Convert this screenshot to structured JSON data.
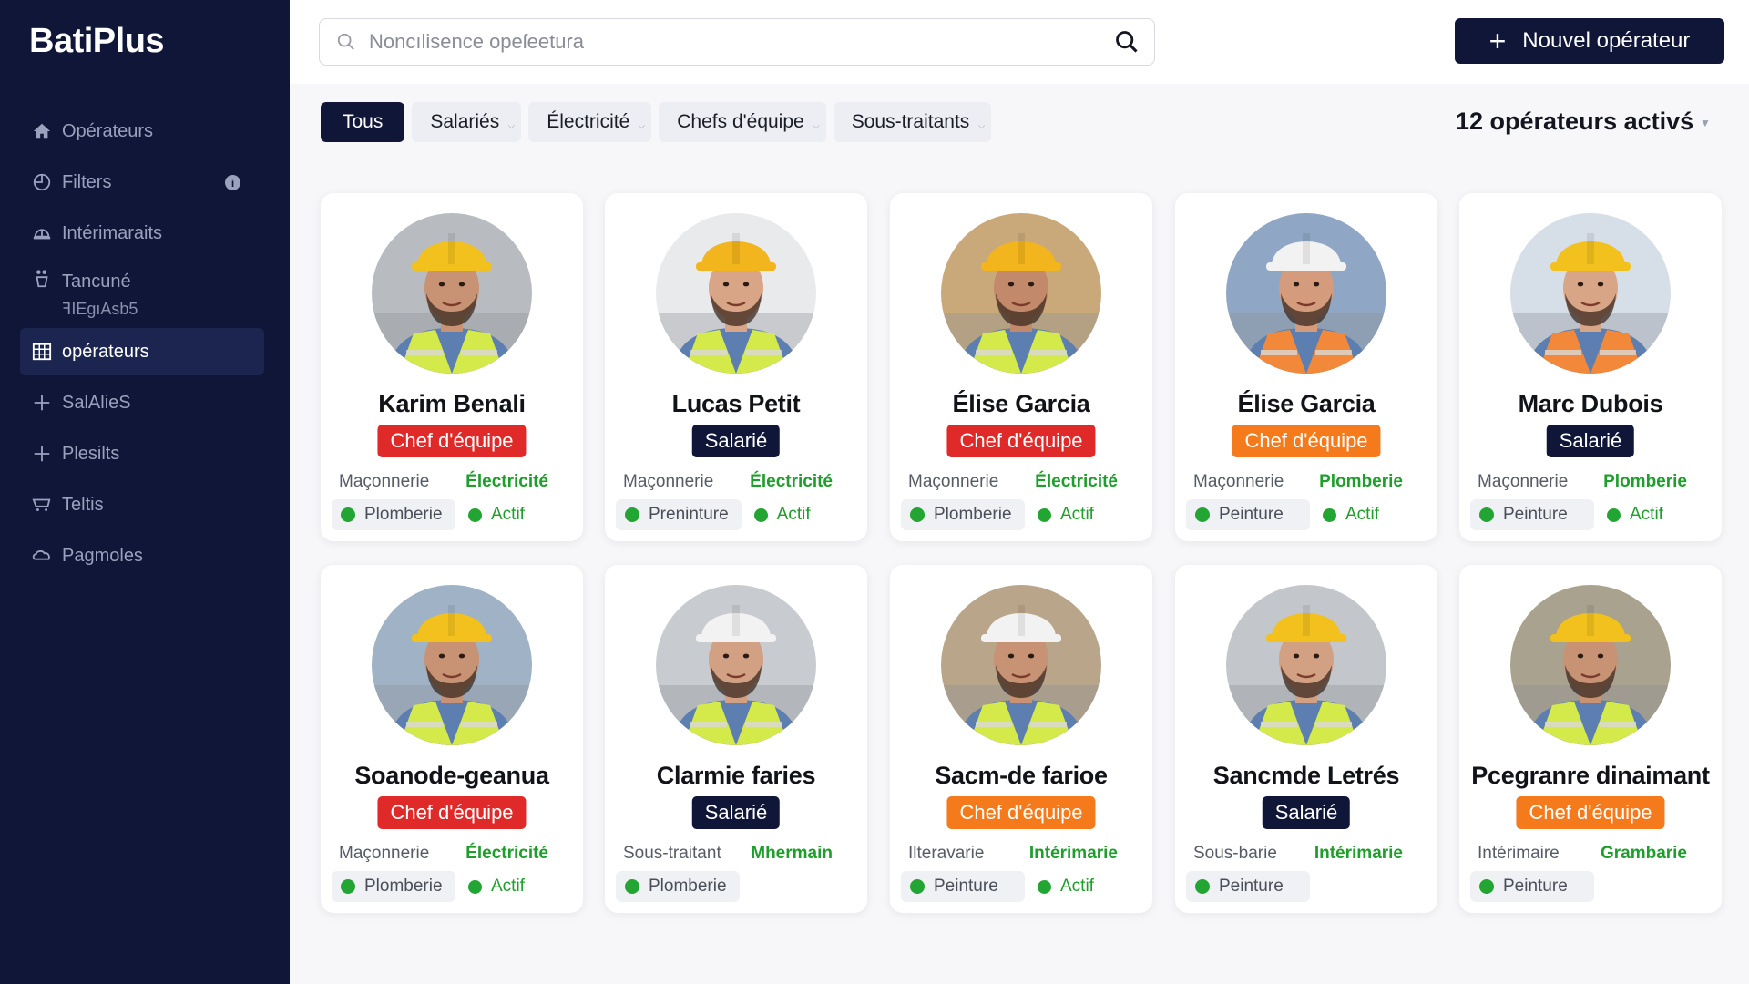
{
  "app": {
    "brand": "BatiPlus"
  },
  "sidebar": {
    "items": [
      {
        "label": "Opérateurs",
        "icon": "home-icon"
      },
      {
        "label": "Filters",
        "icon": "clock-icon",
        "info": "i"
      },
      {
        "label": "Intérimaraits",
        "icon": "helmet-icon"
      },
      {
        "label": "Tancuné",
        "sub": "ꟻIEgıAsb5",
        "icon": "person-icon"
      },
      {
        "label": "opérateurs",
        "icon": "grid-icon",
        "active": true
      },
      {
        "label": "SalAlieS",
        "icon": "plus-icon"
      },
      {
        "label": "Plesilts",
        "icon": "plus-icon"
      },
      {
        "label": "Teltis",
        "icon": "cart-icon"
      },
      {
        "label": "Pagmoles",
        "icon": "cloud-icon"
      }
    ]
  },
  "topbar": {
    "search_placeholder": "Noncılisence opeſeetuɾa",
    "new_button": "Nouvel opérateur"
  },
  "filters": {
    "chips": [
      {
        "label": "Tous",
        "active": true
      },
      {
        "label": "Salariés"
      },
      {
        "label": "Électricité"
      },
      {
        "label": "Chefs d'équipe"
      },
      {
        "label": "Sous-traitants"
      }
    ],
    "count_label": "12 opérateurs activś"
  },
  "colors": {
    "navy": "#0f1638",
    "red_badge": "#e02a2a",
    "orange_badge": "#f57a1c",
    "green": "#22a532"
  },
  "operators": [
    {
      "name": "Karim Benali",
      "role": "Chef d'équipe",
      "role_color": "#e02a2a",
      "left": "Maçonnerie",
      "right": "Électricité",
      "pill": "Plomberie",
      "status": "Actif",
      "helmet": "#f2c11d",
      "vest": "#d4ea4a",
      "skin": "#c89274",
      "bg": "#b8bcc0"
    },
    {
      "name": "Lucas Petit",
      "role": "Salarié",
      "role_color": "#0f1638",
      "left": "Maçonnerie",
      "right": "Électricité",
      "pill": "Preninture",
      "status": "Actif",
      "helmet": "#f2b51d",
      "vest": "#d4ea4a",
      "skin": "#d9a587",
      "bg": "#e9eaec"
    },
    {
      "name": "Élise Garcia",
      "role": "Chef d'équipe",
      "role_color": "#e02a2a",
      "left": "Maçonnerie",
      "right": "Électricité",
      "pill": "Plomberie",
      "status": "Actif",
      "helmet": "#f2b51d",
      "vest": "#d4ea4a",
      "skin": "#c28a6a",
      "bg": "#c9a97a"
    },
    {
      "name": "Élise Garcia",
      "role": "Chef d'équipe",
      "role_color": "#f57a1c",
      "left": "Maçonnerie",
      "right": "Plomberie",
      "pill": "Peinture",
      "status": "Actif",
      "helmet": "#f2f2f2",
      "vest": "#f2893a",
      "skin": "#d49c7c",
      "bg": "#8fa6c4"
    },
    {
      "name": "Marc Dubois",
      "role": "Salarié",
      "role_color": "#0f1638",
      "left": "Maçonnerie",
      "right": "Plomberie",
      "pill": "Peinture",
      "status": "Actif",
      "helmet": "#f2c11d",
      "vest": "#f2893a",
      "skin": "#d9a587",
      "bg": "#d6dee8"
    },
    {
      "name": "Soanode-geanua",
      "role": "Chef d'équipe",
      "role_color": "#e02a2a",
      "left": "Maçonnerie",
      "right": "Électricité",
      "pill": "Plomberie",
      "status": "Actif",
      "helmet": "#f2c11d",
      "vest": "#d4ea4a",
      "skin": "#c89274",
      "bg": "#9fb2c6"
    },
    {
      "name": "Clarmie faries",
      "role": "Salarié",
      "role_color": "#0f1638",
      "left": "Sous-traitant",
      "right": "Mhermain",
      "pill": "Plomberie",
      "status": "",
      "helmet": "#f2f2f2",
      "vest": "#d4ea4a",
      "skin": "#d2a082",
      "bg": "#c8ccd0"
    },
    {
      "name": "Sacm-de farioe",
      "role": "Chef d'équipe",
      "role_color": "#f57a1c",
      "left": "Ilteravarie",
      "right": "Intérimarie",
      "pill": "Peinture",
      "status": "Actif",
      "helmet": "#f2f2f2",
      "vest": "#d4ea4a",
      "skin": "#c89274",
      "bg": "#b9a58a"
    },
    {
      "name": "Sancmde Letrés",
      "role": "Salarié",
      "role_color": "#0f1638",
      "left": "Sous-barie",
      "right": "Intérimarie",
      "pill": "Peinture",
      "status": "",
      "helmet": "#f2c11d",
      "vest": "#d4ea4a",
      "skin": "#d2a082",
      "bg": "#c3c6ca"
    },
    {
      "name": "Pcegranre dinaimant",
      "role": "Chef d'équipe",
      "role_color": "#f57a1c",
      "left": "Intérimaire",
      "right": "Grambarie",
      "pill": "Peinture",
      "status": "",
      "helmet": "#f2c11d",
      "vest": "#d4ea4a",
      "skin": "#c89274",
      "bg": "#a9a28e"
    }
  ]
}
